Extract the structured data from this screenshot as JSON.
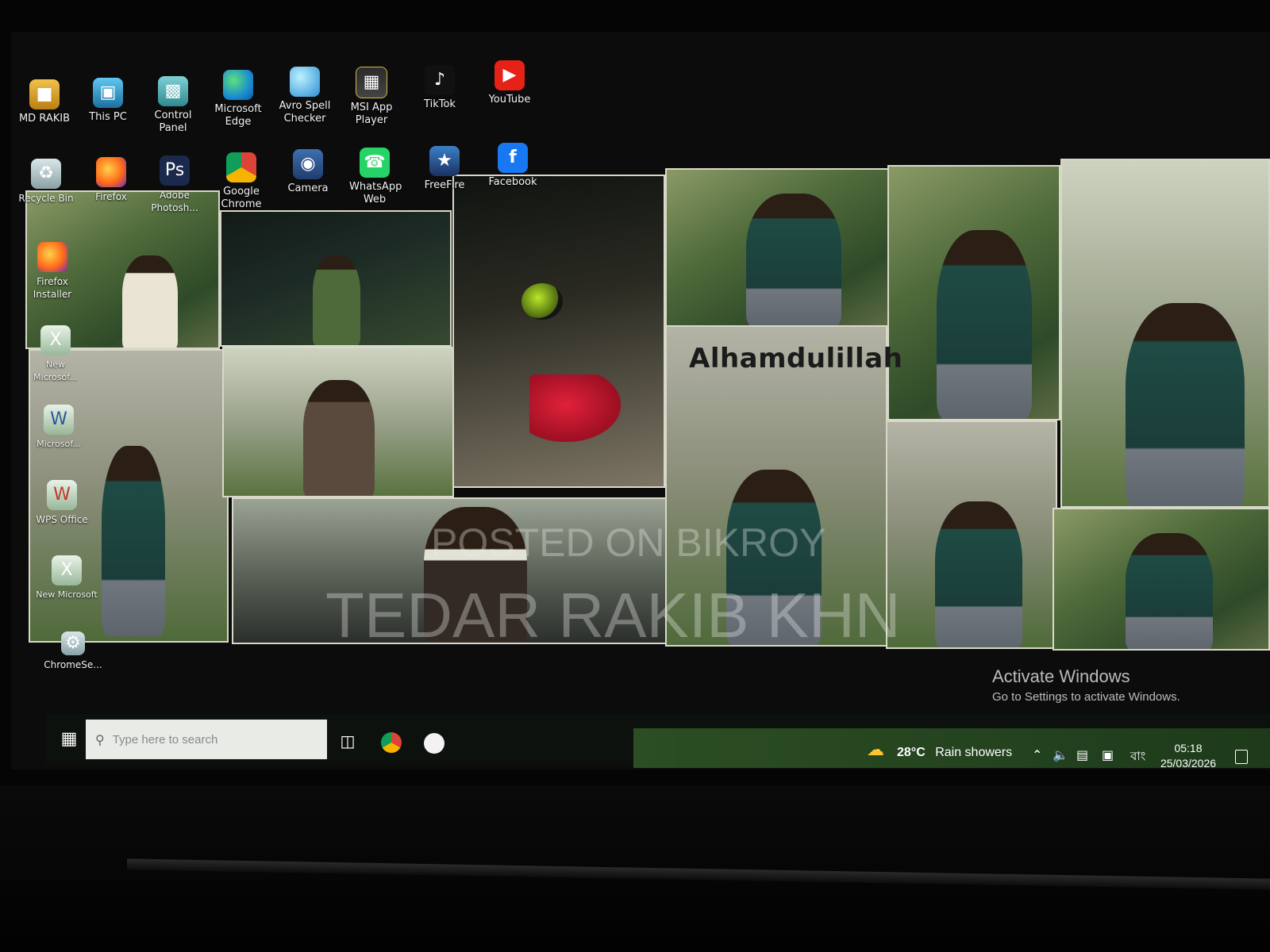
{
  "desktop": {
    "icons_row1": [
      {
        "label": "MD RAKIB",
        "icon": "user-folder-icon"
      },
      {
        "label": "This PC",
        "icon": "this-pc-icon"
      },
      {
        "label": "Control Panel",
        "icon": "control-panel-icon"
      },
      {
        "label": "Microsoft Edge",
        "icon": "edge-icon"
      },
      {
        "label": "Avro Spell Checker",
        "icon": "avro-spell-icon"
      },
      {
        "label": "MSI App Player",
        "icon": "msi-app-player-icon"
      },
      {
        "label": "TikTok",
        "icon": "tiktok-icon"
      },
      {
        "label": "YouTube",
        "icon": "youtube-icon"
      }
    ],
    "icons_row2": [
      {
        "label": "Recycle Bin",
        "icon": "recycle-bin-icon"
      },
      {
        "label": "Firefox",
        "icon": "firefox-icon"
      },
      {
        "label": "Adobe Photosh...",
        "icon": "photoshop-icon"
      },
      {
        "label": "Google Chrome",
        "icon": "chrome-icon"
      },
      {
        "label": "Camera",
        "icon": "camera-icon"
      },
      {
        "label": "WhatsApp Web",
        "icon": "whatsapp-icon"
      },
      {
        "label": "FreeFire",
        "icon": "freefire-icon"
      },
      {
        "label": "Facebook",
        "icon": "facebook-icon"
      }
    ],
    "icons_col": [
      {
        "label": "Firefox Installer",
        "icon": "firefox-installer-icon"
      },
      {
        "label": "New Microsof...",
        "icon": "excel-doc-icon"
      },
      {
        "label": "Microsof...",
        "icon": "word-doc-icon"
      },
      {
        "label": "WPS Office",
        "icon": "wps-office-icon"
      },
      {
        "label": "New Microsoft",
        "icon": "document-icon"
      },
      {
        "label": "ChromeSe...",
        "icon": "chrome-setup-icon"
      }
    ]
  },
  "wallpaper": {
    "caption": "Alhamdulillah",
    "watermark_line1": "POSTED ON BIKROY",
    "watermark_line2": "TEDAR RAKIB KHN"
  },
  "activation": {
    "title": "Activate Windows",
    "subtitle": "Go to Settings to activate Windows."
  },
  "taskbar": {
    "search_placeholder": "Type here to search",
    "weather_temp": "28°C",
    "weather_desc": "Rain showers",
    "language": "বাং",
    "time": "05:18",
    "date": "25/03/2026"
  }
}
